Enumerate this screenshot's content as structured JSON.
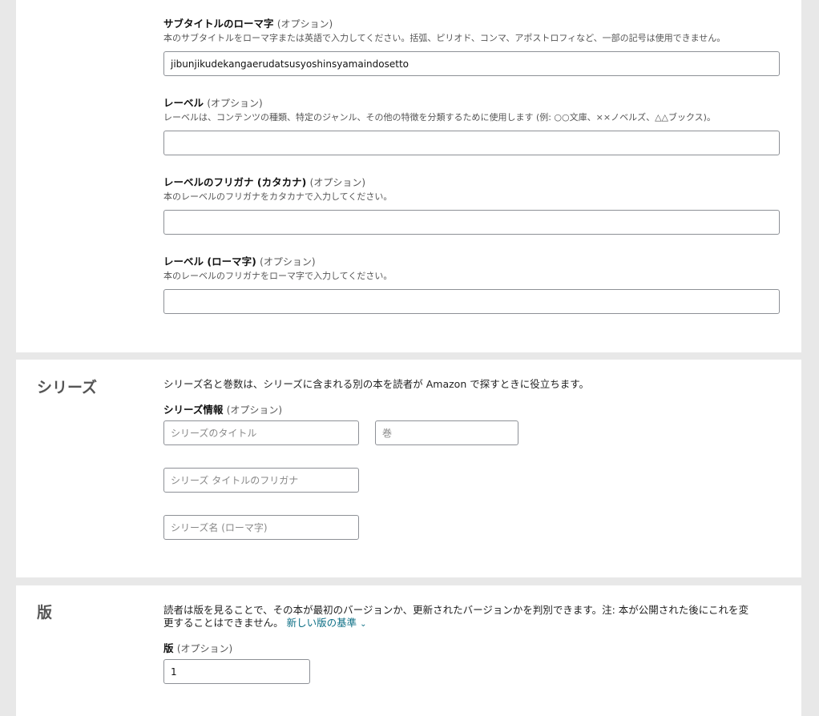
{
  "subtitle_romaji": {
    "label": "サブタイトルのローマ字",
    "optional": "(オプション)",
    "help": "本のサブタイトルをローマ字または英語で入力してください。括弧、ピリオド、コンマ、アポストロフィなど、一部の記号は使用できません。",
    "value": "jibunjikudekangaerudatsusyoshinsyamaindosetto"
  },
  "label_field": {
    "label": "レーベル",
    "optional": "(オプション)",
    "help": "レーベルは、コンテンツの種類、特定のジャンル、その他の特徴を分類するために使用します (例: ○○文庫、××ノベルズ、△△ブックス)。",
    "value": ""
  },
  "label_furigana": {
    "label": "レーベルのフリガナ (カタカナ)",
    "optional": "(オプション)",
    "help": "本のレーベルのフリガナをカタカナで入力してください。",
    "value": ""
  },
  "label_romaji": {
    "label": "レーベル (ローマ字)",
    "optional": "(オプション)",
    "help": "本のレーベルのフリガナをローマ字で入力してください。",
    "value": ""
  },
  "series": {
    "section_title": "シリーズ",
    "description": "シリーズ名と巻数は、シリーズに含まれる別の本を読者が Amazon で探すときに役立ちます。",
    "label": "シリーズ情報",
    "optional": "(オプション)",
    "title_placeholder": "シリーズのタイトル",
    "volume_placeholder": "巻",
    "furigana_placeholder": "シリーズ タイトルのフリガナ",
    "romaji_placeholder": "シリーズ名 (ローマ字)"
  },
  "edition": {
    "section_title": "版",
    "description_line1": "読者は版を見ることで、その本が最初のバージョンか、更新されたバージョンかを判別できます。注: 本が公開された後にこれを変",
    "description_line2": "更することはできません。",
    "link_label": "新しい版の基準",
    "link_icon": "chevron-down-icon",
    "label": "版",
    "optional": "(オプション)",
    "value": "1"
  }
}
